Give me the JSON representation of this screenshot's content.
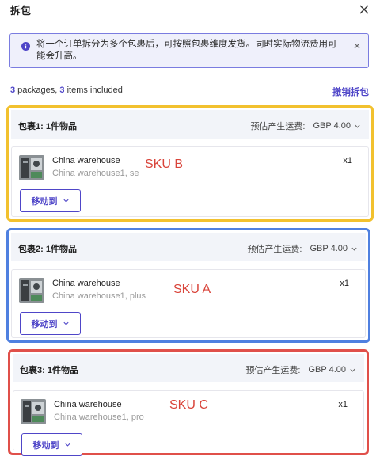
{
  "dialog": {
    "title": "拆包"
  },
  "banner": {
    "text": "将一个订单拆分为多个包裹后，可按照包裹维度发货。同时实际物流费用可能会升高。"
  },
  "summary": {
    "package_count": "3",
    "packages_text": " packages, ",
    "item_count": "3",
    "items_text": " items included",
    "undo_split_label": "撤销拆包"
  },
  "packages": [
    {
      "title": "包裹1: 1件物品",
      "shipping_label": "预估产生运费:",
      "shipping_amount": "GBP 4.00",
      "outline_color": "#f2c12e",
      "item": {
        "warehouse": "China warehouse",
        "detail": "China warehouse1, se",
        "qty": "x1"
      },
      "move_label": "移动到",
      "sku_annotation": "SKU B"
    },
    {
      "title": "包裹2: 1件物品",
      "shipping_label": "预估产生运费:",
      "shipping_amount": "GBP 4.00",
      "outline_color": "#4f80e0",
      "item": {
        "warehouse": "China warehouse",
        "detail": "China warehouse1, plus",
        "qty": "x1"
      },
      "move_label": "移动到",
      "sku_annotation": "SKU A"
    },
    {
      "title": "包裹3: 1件物品",
      "shipping_label": "预估产生运费:",
      "shipping_amount": "GBP 4.00",
      "outline_color": "#e0504a",
      "item": {
        "warehouse": "China warehouse",
        "detail": "China warehouse1, pro",
        "qty": "x1"
      },
      "move_label": "移动到",
      "sku_annotation": "SKU C"
    }
  ],
  "colors": {
    "accent": "#4f46c8",
    "annotation_red": "#d9443a",
    "banner_bg": "#eff0fb"
  },
  "icons": {
    "close": "close-icon",
    "info": "info-icon",
    "chevron": "chevron-down-icon",
    "thumbnail": "product-thumbnail"
  }
}
